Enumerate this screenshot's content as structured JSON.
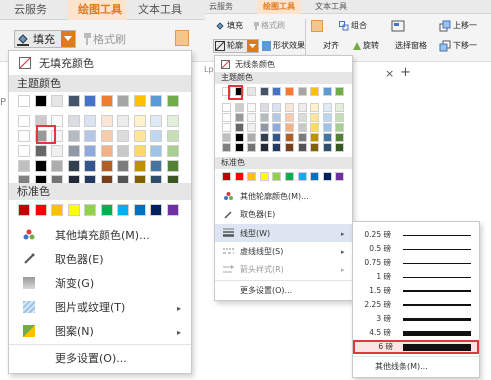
{
  "left": {
    "ribbon_tabs": [
      "云服务",
      "绘图工具",
      "文本工具"
    ],
    "fill_button_label": "填充",
    "format_painter_label": "格式刷",
    "no_fill_label": "无填充颜色",
    "theme_colors_label": "主题颜色",
    "standard_colors_label": "标准色",
    "menu_items": [
      {
        "label": "其他填充颜色(M)...",
        "icon": "palette-icon",
        "has_submenu": false
      },
      {
        "label": "取色器(E)",
        "icon": "eyedropper-icon",
        "has_submenu": false
      },
      {
        "label": "渐变(G)",
        "icon": "gradient-icon",
        "has_submenu": false
      },
      {
        "label": "图片或纹理(T)",
        "icon": "texture-icon",
        "has_submenu": true
      },
      {
        "label": "图案(N)",
        "icon": "pattern-icon",
        "has_submenu": true
      }
    ],
    "more_settings_label": "更多设置(O)...",
    "side_label": "P"
  },
  "right": {
    "ribbon_tabs": [
      "云服务",
      "绘图工具",
      "文本工具"
    ],
    "row1": [
      "填充",
      "格式刷",
      "组合",
      "上移一"
    ],
    "row2": [
      "轮廓",
      "形状效果",
      "对齐",
      "旋转",
      "选择窗格",
      "下移一"
    ],
    "no_line_label": "无线条颜色",
    "theme_colors_label": "主题颜色",
    "standard_colors_label": "标准色",
    "menu_items": [
      {
        "label": "其他轮廓颜色(M)...",
        "icon": "palette-icon",
        "has_submenu": false
      },
      {
        "label": "取色器(E)",
        "icon": "eyedropper-icon",
        "has_submenu": false
      },
      {
        "label": "线型(W)",
        "icon": "line-weight-icon",
        "has_submenu": true
      },
      {
        "label": "虚线线型(S)",
        "icon": "dash-icon",
        "has_submenu": true
      },
      {
        "label": "箭头样式(R)",
        "icon": "arrow-style-icon",
        "has_submenu": true
      }
    ],
    "more_settings_label": "更多设置(O)...",
    "close_symbol": "×",
    "add_symbol": "+",
    "side_label": "Lp"
  },
  "line_weights": {
    "items": [
      {
        "label": "0.25 磅",
        "weight": 0.25
      },
      {
        "label": "0.5 磅",
        "weight": 0.5
      },
      {
        "label": "0.75 磅",
        "weight": 0.75
      },
      {
        "label": "1 磅",
        "weight": 1
      },
      {
        "label": "1.5 磅",
        "weight": 1.5
      },
      {
        "label": "2.25 磅",
        "weight": 2.25
      },
      {
        "label": "3 磅",
        "weight": 3
      },
      {
        "label": "4.5 磅",
        "weight": 4.5
      },
      {
        "label": "6 磅",
        "weight": 6
      }
    ],
    "selected": "6 磅",
    "other_label": "其他线条(M)..."
  },
  "colors": {
    "accent_orange": "#e07b1c",
    "highlight_red": "#e0383e",
    "hover_bg": "#dce5f1",
    "theme_top_row": [
      "#ffffff",
      "#000000",
      "#e7e6e6",
      "#44546a",
      "#4472c4",
      "#ed7d31",
      "#a5a5a5",
      "#ffc000",
      "#5b9bd5",
      "#70ad47"
    ],
    "standard_row": [
      "#c00000",
      "#ff0000",
      "#ffc000",
      "#ffff00",
      "#92d050",
      "#00b050",
      "#00b0f0",
      "#0070c0",
      "#002060",
      "#7030a0"
    ]
  }
}
